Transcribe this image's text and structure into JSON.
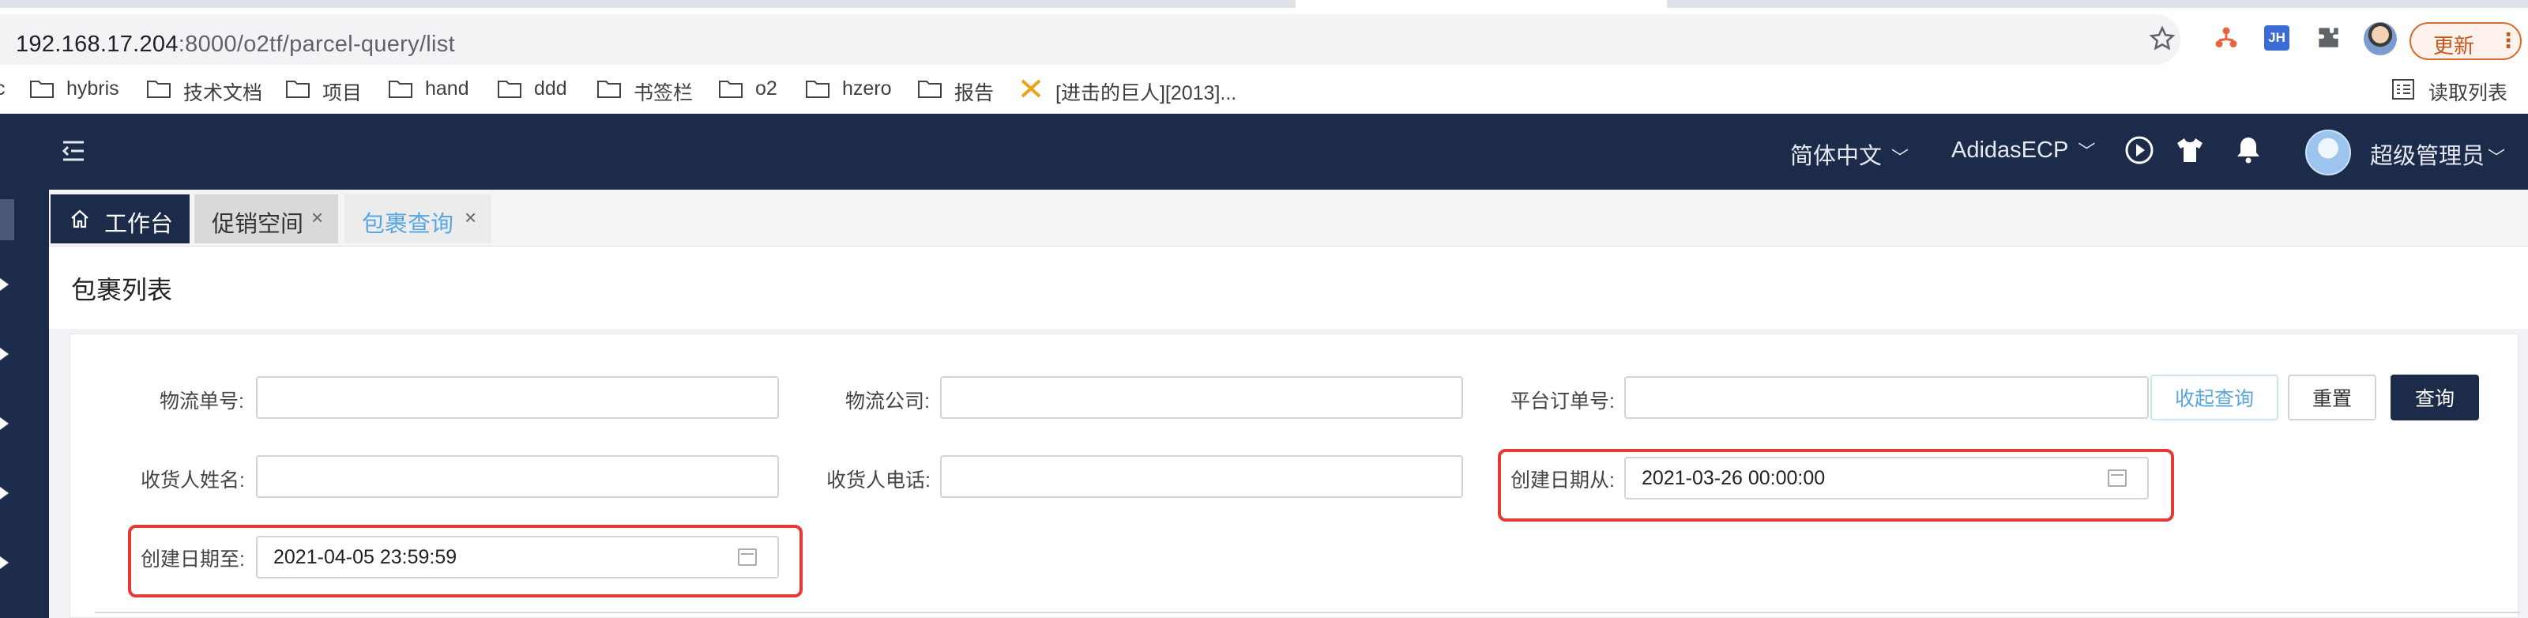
{
  "browser": {
    "url_host": "192.168.17.204",
    "url_path": ":8000/o2tf/parcel-query/list",
    "update_label": "更新",
    "extension_badge": "JH",
    "bookmarks": [
      {
        "label": "hybris",
        "icon": "folder-icon"
      },
      {
        "label": "技术文档",
        "icon": "folder-icon"
      },
      {
        "label": "项目",
        "icon": "folder-icon"
      },
      {
        "label": "hand",
        "icon": "folder-icon"
      },
      {
        "label": "ddd",
        "icon": "folder-icon"
      },
      {
        "label": "书签栏",
        "icon": "folder-icon"
      },
      {
        "label": "o2",
        "icon": "folder-icon"
      },
      {
        "label": "hzero",
        "icon": "folder-icon"
      },
      {
        "label": "报告",
        "icon": "folder-icon"
      },
      {
        "label": "[进击的巨人][2013]...",
        "icon": "bookmark-favicon"
      }
    ],
    "reading_list": "读取列表"
  },
  "header": {
    "language": "简体中文",
    "tenant": "AdidasECP",
    "user": "超级管理员"
  },
  "tabs": [
    {
      "label": "工作台",
      "icon": "home-icon"
    },
    {
      "label": "促销空间"
    },
    {
      "label": "包裹查询"
    }
  ],
  "page": {
    "title": "包裹列表"
  },
  "form": {
    "logistics_no_label": "物流单号:",
    "logistics_company_label": "物流公司:",
    "platform_order_label": "平台订单号:",
    "receiver_name_label": "收货人姓名:",
    "receiver_phone_label": "收货人电话:",
    "created_from_label": "创建日期从:",
    "created_from_value": "2021-03-26 00:00:00",
    "created_to_label": "创建日期至:",
    "created_to_value": "2021-04-05 23:59:59"
  },
  "buttons": {
    "collapse": "收起查询",
    "reset": "重置",
    "query": "查询"
  },
  "colors": {
    "header_bg": "#1d2b4a",
    "highlight": "#e53935",
    "link_blue": "#5aa7e0"
  }
}
